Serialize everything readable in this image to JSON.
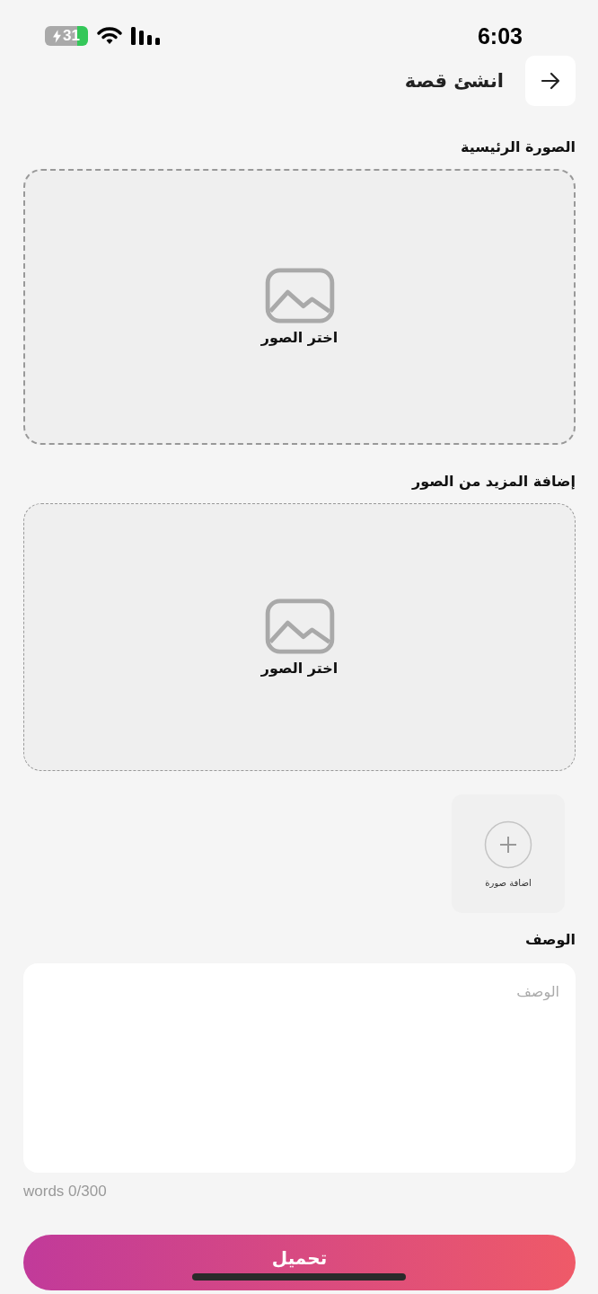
{
  "status_bar": {
    "time": "6:03",
    "battery": "31",
    "charging": true
  },
  "header": {
    "title": "انشئ قصة"
  },
  "main_image": {
    "label": "الصورة الرئيسية",
    "prompt": "اختر الصور"
  },
  "more_images": {
    "label": "إضافة المزيد من الصور",
    "prompt": "اختر الصور",
    "add_tile": "اضافة صورة"
  },
  "description": {
    "label": "الوصف",
    "placeholder": "الوصف",
    "counter": "words 0/300"
  },
  "submit": {
    "label": "تحميل"
  }
}
